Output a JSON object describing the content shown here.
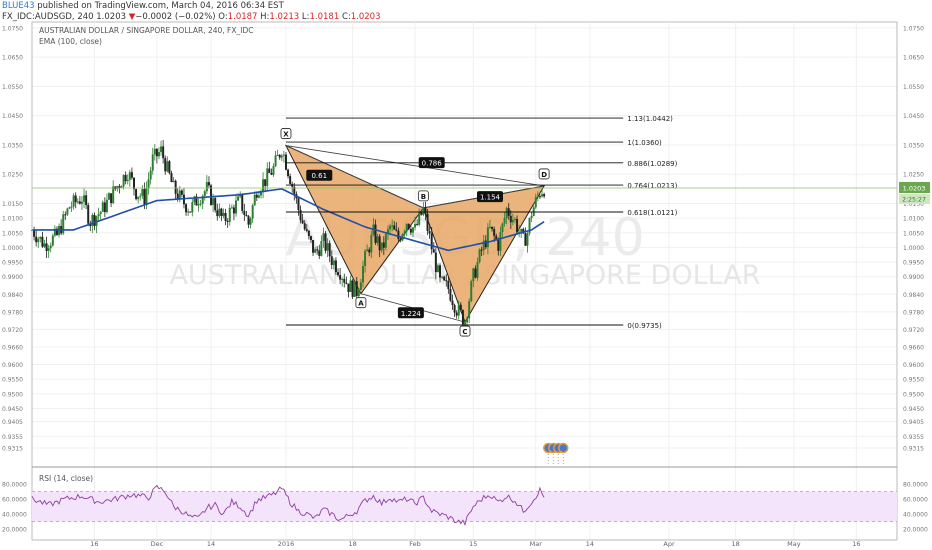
{
  "header": {
    "user": "BLUE43",
    "published": "published on TradingView.com, March 04, 2016 06:34 EST",
    "symbol": "FX_IDC:AUDSGD, 240",
    "price": "1.0203",
    "change_arrow": "▼",
    "change": "−0.0002 (−0.02%)",
    "o_label": "O:",
    "o": "1.0187",
    "h_label": "H:",
    "h": "1.0213",
    "l_label": "L:",
    "l": "1.0181",
    "c_label": "C:",
    "c": "1.0203"
  },
  "pane": {
    "title": "AUSTRALIAN DOLLAR / SINGAPORE DOLLAR, 240, FX_IDC",
    "ema_label": "EMA (100, close)",
    "watermark_symbol": "AUDSGD, 240",
    "watermark_name": "AUSTRALIAN DOLLAR / SINGAPORE DOLLAR",
    "price_tag": "1.0203",
    "ema_tag": "2:25:27"
  },
  "rsi": {
    "label": "RSI (14, close)",
    "ticks": [
      "80.0000",
      "60.0000",
      "40.0000",
      "20.0000"
    ],
    "tick_values": [
      80,
      60,
      40,
      20
    ],
    "band": [
      30,
      70
    ]
  },
  "colors": {
    "up": "#2e7d32",
    "down": "#222222",
    "ema": "#1f4fa8",
    "pattern_fill": "#e8a765",
    "pattern_stroke": "#222222",
    "rsi_line": "#8e3fa0",
    "rsi_band": "#f3e4fb",
    "price_line": "#8fbf60"
  },
  "chart_data": {
    "type": "candlestick",
    "ylim": [
      0.925,
      1.077
    ],
    "y_ticks": [
      "1.0750",
      "1.0650",
      "1.0550",
      "1.0450",
      "1.0350",
      "1.0250",
      "1.0150",
      "1.0100",
      "1.0050",
      "1.0000",
      "0.9950",
      "0.9900",
      "0.9840",
      "0.9780",
      "0.9720",
      "0.9660",
      "0.9600",
      "0.9550",
      "0.9500",
      "0.9450",
      "0.9405",
      "0.9355",
      "0.9315"
    ],
    "y_tick_values": [
      1.075,
      1.065,
      1.055,
      1.045,
      1.035,
      1.025,
      1.015,
      1.01,
      1.005,
      1.0,
      0.995,
      0.99,
      0.984,
      0.978,
      0.972,
      0.966,
      0.96,
      0.955,
      0.95,
      0.945,
      0.9405,
      0.9355,
      0.9315
    ],
    "x_ticks": [
      "16",
      "Dec",
      "14",
      "2016",
      "18",
      "Feb",
      "15",
      "Mar",
      "14",
      "Apr",
      "18",
      "May",
      "16"
    ],
    "x_tick_days": [
      15,
      30,
      43,
      61,
      77,
      92,
      106,
      121,
      134,
      153,
      169,
      183,
      198
    ],
    "fib_levels": [
      {
        "label": "1.13(1.0442)",
        "value": 1.0442
      },
      {
        "label": "1(1.0360)",
        "value": 1.036
      },
      {
        "label": "0.886(1.0289)",
        "value": 1.0289
      },
      {
        "label": "0.764(1.0213)",
        "value": 1.0213
      },
      {
        "label": "0.618(1.0121)",
        "value": 1.0121
      },
      {
        "label": "0(0.9735)",
        "value": 0.9735
      }
    ],
    "pattern_points": [
      {
        "label": "X",
        "day": 61,
        "value": 1.0348
      },
      {
        "label": "A",
        "day": 79,
        "value": 0.9842
      },
      {
        "label": "B",
        "day": 94,
        "value": 1.0135
      },
      {
        "label": "C",
        "day": 104,
        "value": 0.9745
      },
      {
        "label": "D",
        "day": 123,
        "value": 1.021
      }
    ],
    "ratios": [
      {
        "label": "0.61",
        "day": 69,
        "value": 1.0245
      },
      {
        "label": "0.786",
        "day": 96,
        "value": 1.0288
      },
      {
        "label": "1.154",
        "day": 110,
        "value": 1.0172
      },
      {
        "label": "1.224",
        "day": 91,
        "value": 0.9775
      }
    ],
    "price_last": 1.0203,
    "ema_last": 1.0088,
    "price_anchors": [
      [
        0,
        1.006
      ],
      [
        3,
        1.001
      ],
      [
        6,
        1.004
      ],
      [
        9,
        1.014
      ],
      [
        12,
        1.017
      ],
      [
        14,
        1.009
      ],
      [
        17,
        1.013
      ],
      [
        20,
        1.02
      ],
      [
        23,
        1.026
      ],
      [
        25,
        1.019
      ],
      [
        27,
        1.017
      ],
      [
        29,
        1.03
      ],
      [
        31,
        1.033
      ],
      [
        34,
        1.02
      ],
      [
        36,
        1.016
      ],
      [
        38,
        1.013
      ],
      [
        40,
        1.017
      ],
      [
        42,
        1.02
      ],
      [
        44,
        1.014
      ],
      [
        46,
        1.009
      ],
      [
        48,
        1.013
      ],
      [
        50,
        1.016
      ],
      [
        52,
        1.008
      ],
      [
        54,
        1.02
      ],
      [
        56,
        1.023
      ],
      [
        58,
        1.027
      ],
      [
        60,
        1.034
      ],
      [
        62,
        1.024
      ],
      [
        64,
        1.013
      ],
      [
        66,
        1.004
      ],
      [
        68,
        0.998
      ],
      [
        70,
        1.002
      ],
      [
        72,
        0.996
      ],
      [
        74,
        0.992
      ],
      [
        76,
        0.987
      ],
      [
        78,
        0.985
      ],
      [
        80,
        0.996
      ],
      [
        82,
        1.005
      ],
      [
        84,
        0.999
      ],
      [
        86,
        1.007
      ],
      [
        88,
        1.003
      ],
      [
        90,
        1.009
      ],
      [
        92,
        1.006
      ],
      [
        94,
        1.013
      ],
      [
        96,
        1.0
      ],
      [
        98,
        0.988
      ],
      [
        100,
        0.986
      ],
      [
        102,
        0.979
      ],
      [
        104,
        0.975
      ],
      [
        106,
        0.99
      ],
      [
        108,
        0.999
      ],
      [
        110,
        1.006
      ],
      [
        112,
        1.001
      ],
      [
        114,
        1.013
      ],
      [
        116,
        1.009
      ],
      [
        118,
        1.002
      ],
      [
        119,
        1.005
      ],
      [
        120,
        1.012
      ],
      [
        122,
        1.019
      ],
      [
        123,
        1.0203
      ]
    ],
    "ema_anchors": [
      [
        0,
        1.006
      ],
      [
        10,
        1.006
      ],
      [
        20,
        1.011
      ],
      [
        30,
        1.016
      ],
      [
        40,
        1.017
      ],
      [
        50,
        1.018
      ],
      [
        60,
        1.02
      ],
      [
        70,
        1.013
      ],
      [
        80,
        1.007
      ],
      [
        90,
        1.003
      ],
      [
        100,
        0.999
      ],
      [
        110,
        1.002
      ],
      [
        120,
        1.006
      ],
      [
        123,
        1.0088
      ]
    ],
    "rsi_anchors": [
      [
        0,
        60
      ],
      [
        4,
        52
      ],
      [
        8,
        60
      ],
      [
        12,
        64
      ],
      [
        16,
        56
      ],
      [
        20,
        60
      ],
      [
        24,
        66
      ],
      [
        28,
        62
      ],
      [
        30,
        76
      ],
      [
        32,
        70
      ],
      [
        34,
        50
      ],
      [
        36,
        44
      ],
      [
        38,
        36
      ],
      [
        40,
        34
      ],
      [
        42,
        48
      ],
      [
        44,
        52
      ],
      [
        46,
        40
      ],
      [
        48,
        56
      ],
      [
        50,
        50
      ],
      [
        52,
        38
      ],
      [
        54,
        58
      ],
      [
        56,
        62
      ],
      [
        58,
        66
      ],
      [
        60,
        74
      ],
      [
        62,
        56
      ],
      [
        64,
        44
      ],
      [
        66,
        40
      ],
      [
        68,
        34
      ],
      [
        70,
        46
      ],
      [
        72,
        40
      ],
      [
        74,
        32
      ],
      [
        76,
        38
      ],
      [
        78,
        44
      ],
      [
        80,
        58
      ],
      [
        82,
        64
      ],
      [
        84,
        54
      ],
      [
        86,
        62
      ],
      [
        88,
        56
      ],
      [
        90,
        60
      ],
      [
        92,
        54
      ],
      [
        94,
        62
      ],
      [
        96,
        44
      ],
      [
        98,
        40
      ],
      [
        100,
        36
      ],
      [
        102,
        30
      ],
      [
        104,
        28
      ],
      [
        106,
        50
      ],
      [
        108,
        60
      ],
      [
        110,
        66
      ],
      [
        112,
        56
      ],
      [
        114,
        64
      ],
      [
        116,
        58
      ],
      [
        118,
        44
      ],
      [
        120,
        56
      ],
      [
        121,
        64
      ],
      [
        122,
        72
      ],
      [
        123,
        62
      ]
    ]
  }
}
